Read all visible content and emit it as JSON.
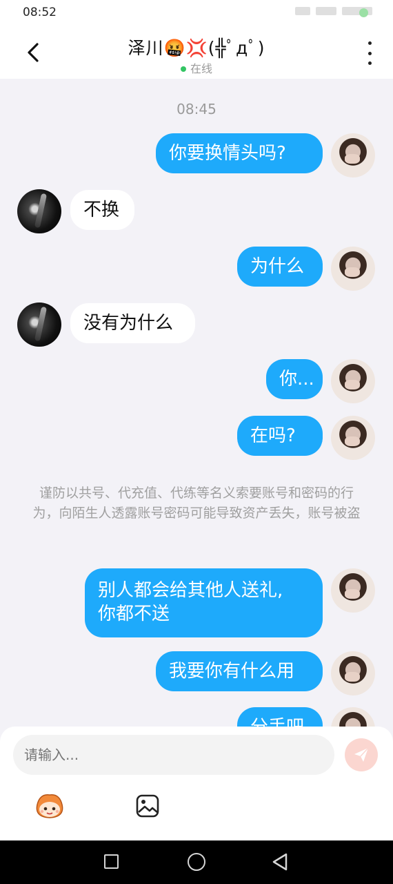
{
  "status_bar": {
    "time": "08:52"
  },
  "header": {
    "title": "泽川🤬💢(╬ﾟдﾟ)",
    "status": "在线",
    "status_color": "#33c463"
  },
  "chat": {
    "timestamp": "08:45",
    "messages": [
      {
        "from": "me",
        "text": "你要换情头吗?"
      },
      {
        "from": "other",
        "text": "不换"
      },
      {
        "from": "me",
        "text": "为什么"
      },
      {
        "from": "other",
        "text": "没有为什么"
      },
      {
        "from": "me",
        "text": "你..."
      },
      {
        "from": "me",
        "text": "在吗?"
      },
      {
        "from": "me",
        "text": "别人都会给其他人送礼,\n你都不送"
      },
      {
        "from": "me",
        "text": "我要你有什么用"
      },
      {
        "from": "me",
        "text": "分手吧"
      }
    ],
    "system_notice": "谨防以共号、代充值、代练等名义索要账号和密码的行为，向陌生人透露账号密码可能导致资产丢失，账号被盗",
    "bubble_color_out": "#1eaafb",
    "bubble_color_in": "#ffffff"
  },
  "composer": {
    "placeholder": "请输入...",
    "send_icon": "send-icon",
    "emoji_icon": "emoji-face-icon",
    "image_icon": "image-icon"
  },
  "navbar": {
    "recent_icon": "recent-apps-icon",
    "home_icon": "home-icon",
    "back_icon": "back-icon"
  }
}
